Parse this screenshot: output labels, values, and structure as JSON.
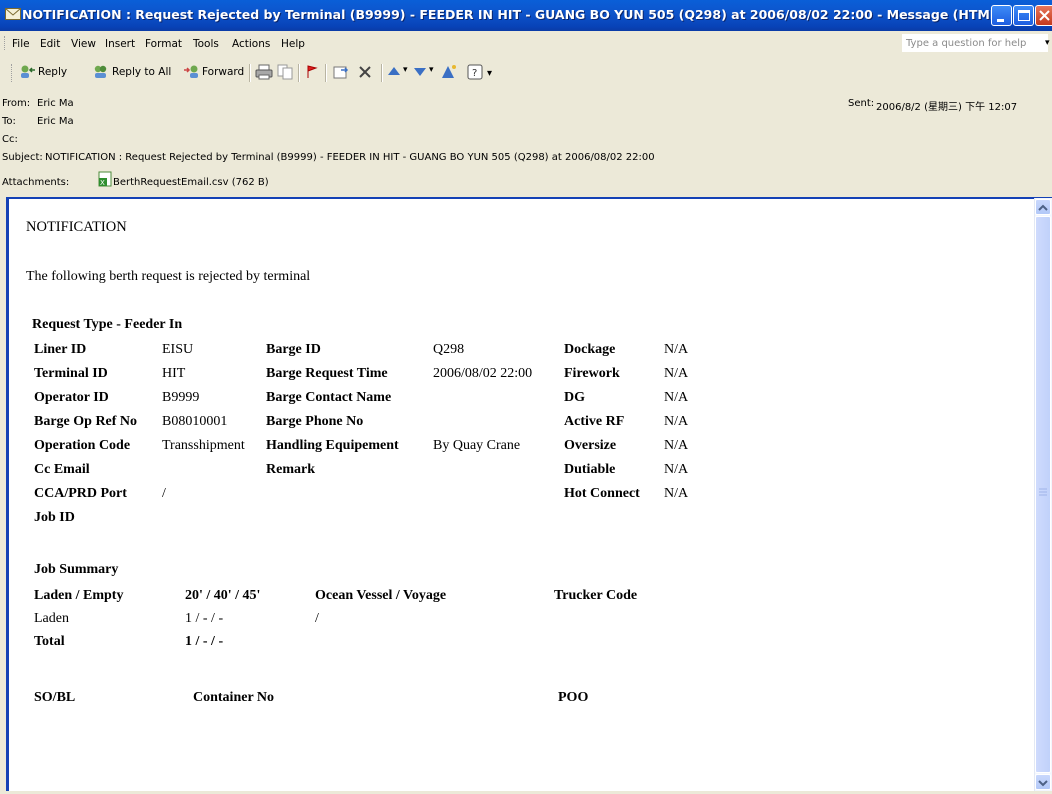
{
  "window": {
    "title": "NOTIFICATION : Request Rejected by Terminal (B9999) - FEEDER IN HIT - GUANG BO YUN 505 (Q298) at 2006/08/02 22:00 - Message (HTML)"
  },
  "menu": {
    "items": [
      "File",
      "Edit",
      "View",
      "Insert",
      "Format",
      "Tools",
      "Actions",
      "Help"
    ],
    "help_placeholder": "Type a question for help"
  },
  "toolbar": {
    "reply": "Reply",
    "reply_all": "Reply to All",
    "forward": "Forward"
  },
  "header": {
    "from_label": "From:",
    "from_value": "Eric Ma",
    "to_label": "To:",
    "to_value": "Eric Ma",
    "cc_label": "Cc:",
    "subject_label": "Subject:",
    "subject_value": "NOTIFICATION : Request Rejected by Terminal (B9999) - FEEDER IN HIT - GUANG BO YUN 505 (Q298) at 2006/08/02 22:00",
    "sent_label": "Sent:",
    "sent_value": "2006/8/2 (星期三) 下午 12:07",
    "attachments_label": "Attachments:",
    "attachment_name": "BerthRequestEmail.csv (762 B)"
  },
  "message": {
    "heading": "NOTIFICATION",
    "intro": "The following berth request is rejected by terminal",
    "request_type": "Request Type - Feeder In",
    "col1": [
      {
        "label": "Liner ID",
        "value": "EISU"
      },
      {
        "label": "Terminal ID",
        "value": "HIT"
      },
      {
        "label": "Operator ID",
        "value": "B9999"
      },
      {
        "label": "Barge Op Ref No",
        "value": "B08010001"
      },
      {
        "label": "Operation Code",
        "value": "Transshipment"
      },
      {
        "label": "Cc Email",
        "value": ""
      },
      {
        "label": "CCA/PRD Port",
        "value": "/"
      },
      {
        "label": "Job ID",
        "value": ""
      }
    ],
    "col2": [
      {
        "label": "Barge ID",
        "value": "Q298"
      },
      {
        "label": "Barge Request Time",
        "value": "2006/08/02 22:00"
      },
      {
        "label": "Barge Contact Name",
        "value": ""
      },
      {
        "label": "Barge Phone No",
        "value": ""
      },
      {
        "label": "Handling Equipement",
        "value": "By Quay Crane"
      },
      {
        "label": "Remark",
        "value": ""
      }
    ],
    "col3": [
      {
        "label": "Dockage",
        "value": "N/A"
      },
      {
        "label": "Firework",
        "value": "N/A"
      },
      {
        "label": "DG",
        "value": "N/A"
      },
      {
        "label": "Active RF",
        "value": "N/A"
      },
      {
        "label": "Oversize",
        "value": "N/A"
      },
      {
        "label": "Dutiable",
        "value": "N/A"
      },
      {
        "label": "Hot Connect",
        "value": "N/A"
      }
    ],
    "job_summary": {
      "title": "Job Summary",
      "headers": [
        "Laden / Empty",
        "20' / 40' / 45'",
        "Ocean Vessel / Voyage",
        "Trucker Code"
      ],
      "row": [
        "Laden",
        "1 / - / -",
        "/"
      ],
      "total_label": "Total",
      "total_value": "1 / - / -"
    },
    "container_headers": [
      "SO/BL",
      "Container No",
      "POO"
    ]
  }
}
